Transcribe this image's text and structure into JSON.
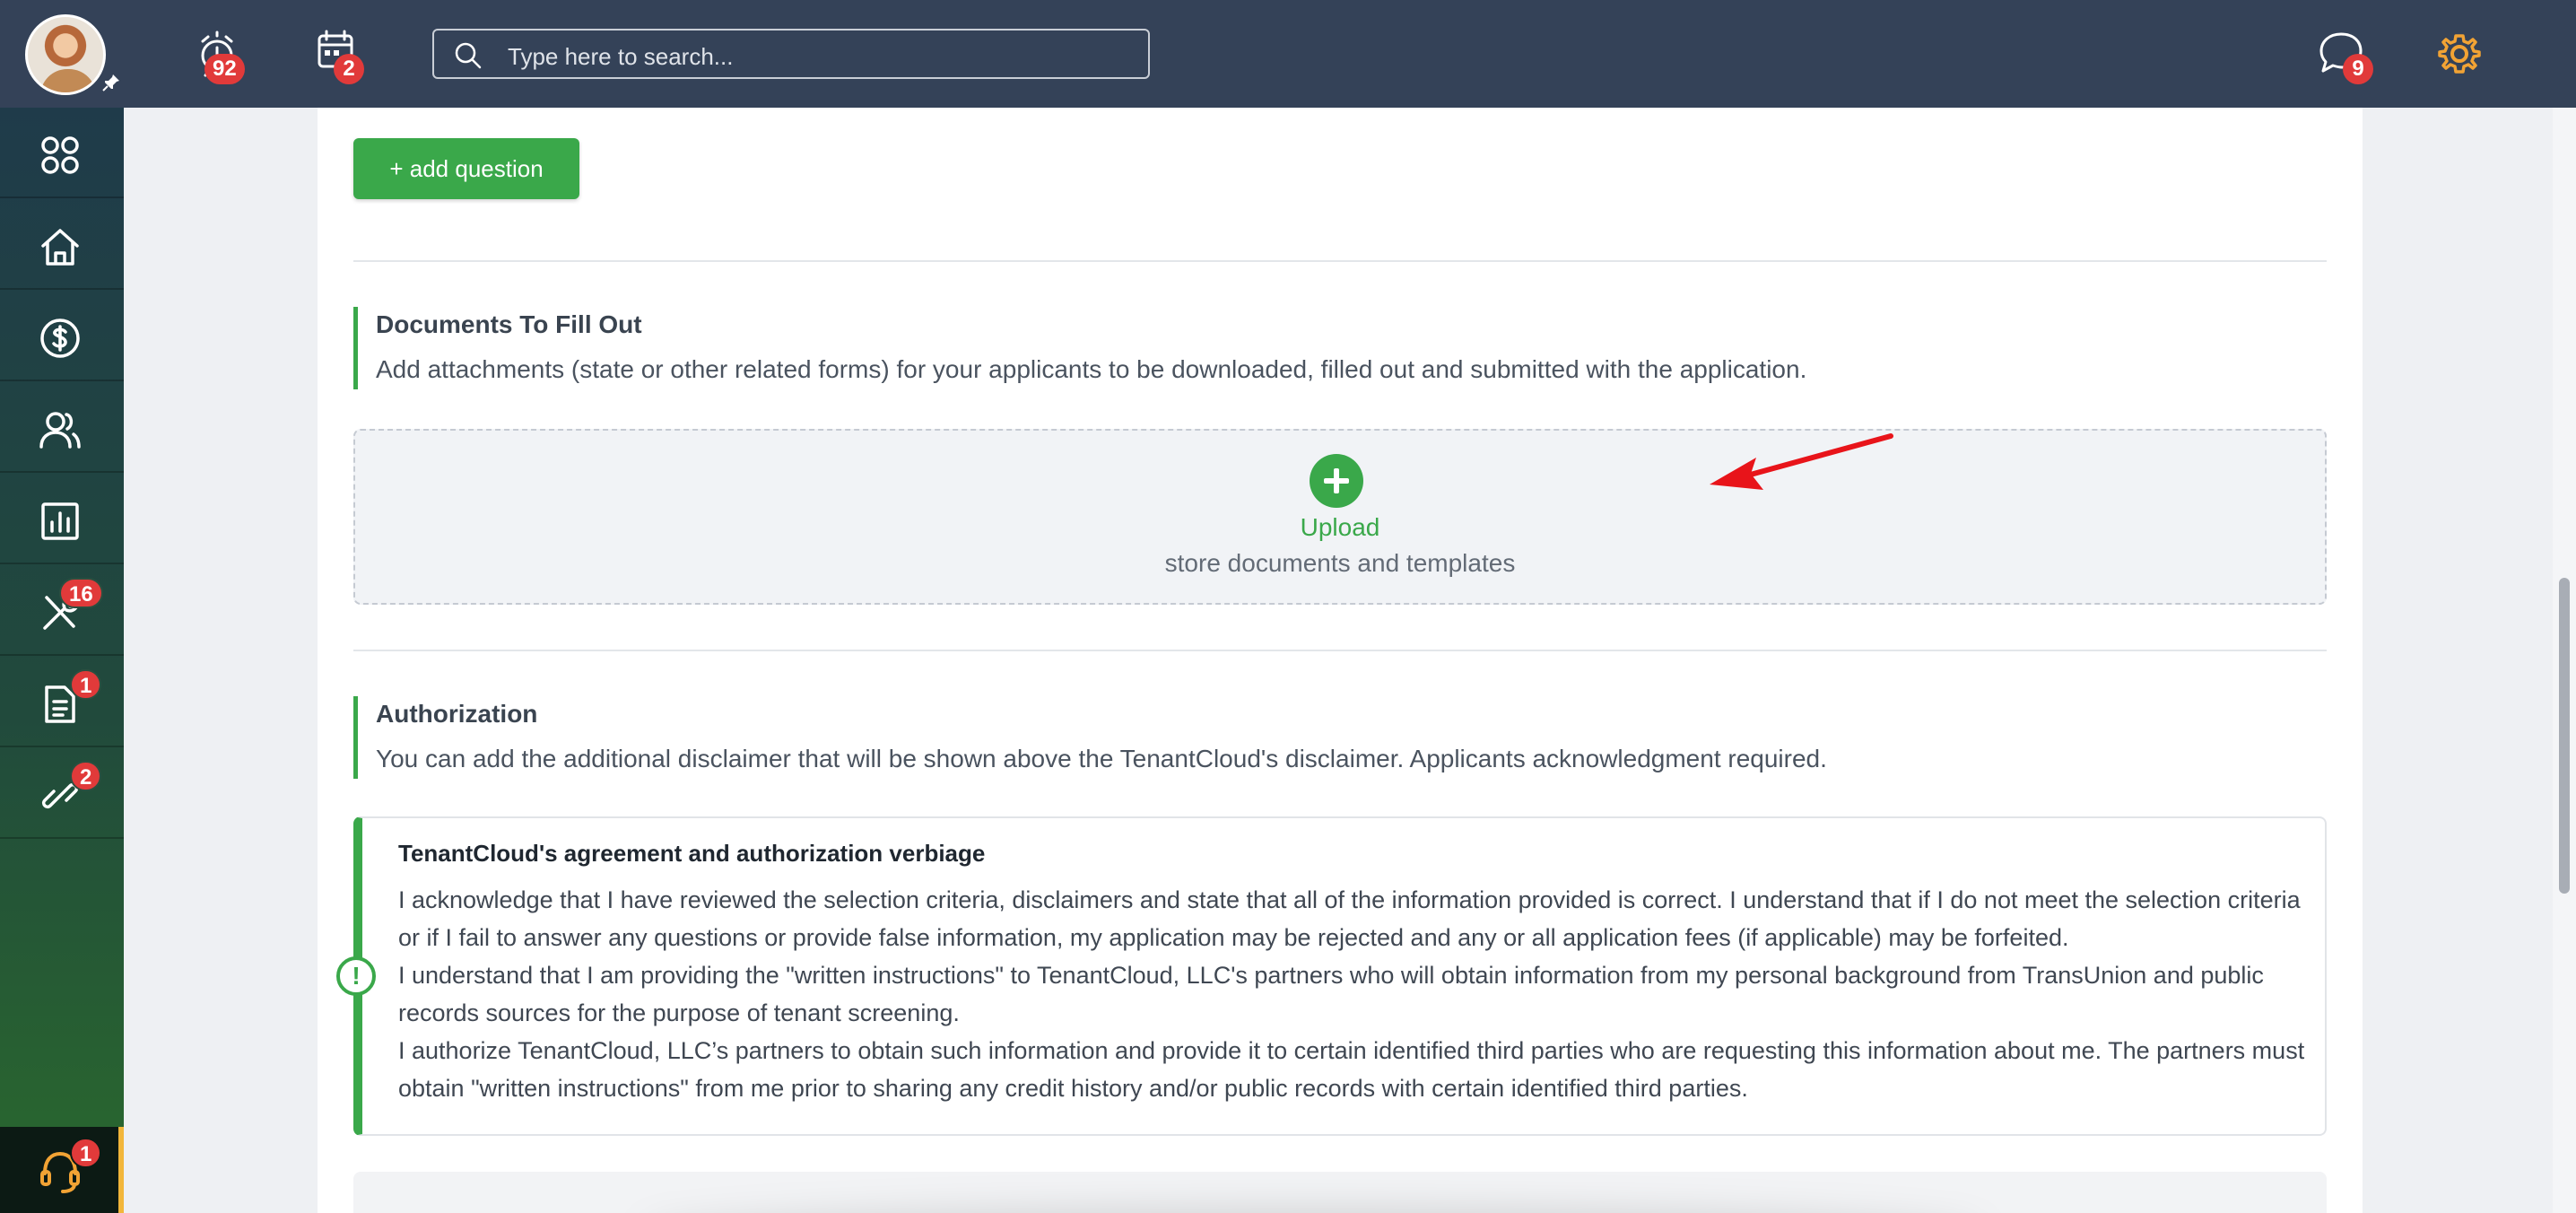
{
  "topbar": {
    "alarm_count": "92",
    "calendar_count": "2",
    "search_placeholder": "Type here to search...",
    "messages_count": "9",
    "icons": [
      "avatar",
      "pin-icon",
      "alarm-clock-icon",
      "calendar-icon",
      "search-icon",
      "chat-icon",
      "gear-icon"
    ]
  },
  "sidebar": {
    "items": [
      {
        "name": "apps",
        "icon": "grid-icon",
        "badge": null
      },
      {
        "name": "home",
        "icon": "home-icon",
        "badge": null
      },
      {
        "name": "payments",
        "icon": "dollar-icon",
        "badge": null
      },
      {
        "name": "people",
        "icon": "users-icon",
        "badge": null
      },
      {
        "name": "reports",
        "icon": "chart-icon",
        "badge": null
      },
      {
        "name": "maintenance",
        "icon": "tools-icon",
        "badge": "16"
      },
      {
        "name": "documents",
        "icon": "document-icon",
        "badge": "1"
      },
      {
        "name": "links",
        "icon": "link-icon",
        "badge": "2"
      }
    ],
    "support_badge": "1"
  },
  "main": {
    "add_question_label": "+ add question",
    "documents": {
      "title": "Documents To Fill Out",
      "description": "Add attachments (state or other related forms) for your applicants to be downloaded, filled out and submitted with the application.",
      "upload_label": "Upload",
      "upload_sub": "store documents and templates"
    },
    "authorization": {
      "title": "Authorization",
      "description": "You can add the additional disclaimer that will be shown above the TenantCloud's disclaimer. Applicants acknowledgment required."
    },
    "agreement": {
      "title": "TenantCloud's agreement and authorization verbiage",
      "paragraph1": "I acknowledge that I have reviewed the selection criteria, disclaimers and state that all of the information provided is correct. I understand that if I do not meet the selection criteria or if I fail to answer any questions or provide false information, my application may be rejected and any or all application fees (if applicable) may be forfeited.",
      "paragraph2": "I understand that I am providing the \"written instructions\" to TenantCloud, LLC's partners who will obtain information from my personal background from TransUnion and public records sources for the purpose of tenant screening.",
      "paragraph3": "I authorize TenantCloud, LLC’s partners to obtain such information and provide it to certain identified third parties who are requesting this information about me. The partners must obtain \"written instructions\" from me prior to sharing any credit history and/or public records with certain identified third parties.",
      "icon": "exclamation-circle-icon"
    }
  },
  "colors": {
    "topbar": "#344258",
    "accent_green": "#3aa84a",
    "badge_red": "#e13a3a",
    "gear_orange": "#f2a334",
    "arrow_red": "#e8141a"
  }
}
